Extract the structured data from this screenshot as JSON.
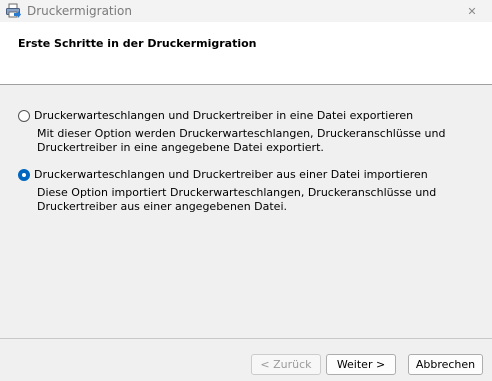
{
  "window": {
    "title": "Druckermigration",
    "close_glyph": "✕"
  },
  "header": {
    "title": "Erste Schritte in der Druckermigration"
  },
  "options": [
    {
      "label": "Druckerwarteschlangen und Druckertreiber in eine Datei exportieren",
      "description": "Mit dieser Option werden Druckerwarteschlangen, Druckeranschlüsse und Druckertreiber in eine angegebene Datei exportiert.",
      "selected": false
    },
    {
      "label": "Druckerwarteschlangen und Druckertreiber aus einer Datei importieren",
      "description": "Diese Option importiert Druckerwarteschlangen, Druckeranschlüsse und Druckertreiber aus einer angegebenen Datei.",
      "selected": true
    }
  ],
  "buttons": {
    "back": "< Zurück",
    "next": "Weiter >",
    "cancel": "Abbrechen"
  },
  "colors": {
    "accent": "#0067c0",
    "header_bg": "#ffffff",
    "dialog_bg": "#f0f0f0"
  },
  "icons": {
    "app": "printer-migration-icon",
    "close": "close-icon"
  }
}
